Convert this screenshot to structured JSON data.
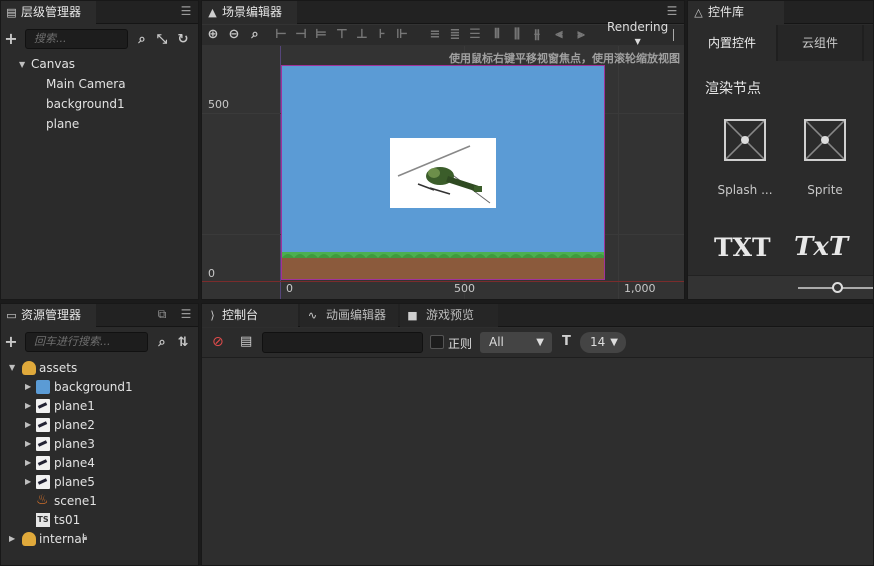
{
  "hierarchy": {
    "title": "层级管理器",
    "search_placeholder": "搜索...",
    "nodes": [
      {
        "label": "Canvas"
      },
      {
        "label": "Main Camera"
      },
      {
        "label": "background1"
      },
      {
        "label": "plane"
      }
    ]
  },
  "scene": {
    "title": "场景编辑器",
    "rendering_label": "Rendering",
    "hint": "使用鼠标右键平移视窗焦点，使用滚轮缩放视图",
    "ruler_left": [
      "500",
      "0"
    ],
    "ruler_bottom": [
      "0",
      "500",
      "1,000"
    ],
    "sky_color": "#5b9bd5",
    "ground_color": "#8b5a3c",
    "grass_color": "#4caf50"
  },
  "library": {
    "title": "控件库",
    "tabs": [
      "内置控件",
      "云组件"
    ],
    "section_title": "渲染节点",
    "items": [
      {
        "label": "Splash ..."
      },
      {
        "label": "Sprite"
      }
    ],
    "text_items": [
      "TXT",
      "TxT"
    ]
  },
  "assets": {
    "title": "资源管理器",
    "search_placeholder": "回车进行搜索...",
    "items": [
      {
        "label": "assets",
        "icon": "folder-icon"
      },
      {
        "label": "background1",
        "icon": "texture-icon"
      },
      {
        "label": "plane1",
        "icon": "plane-icon"
      },
      {
        "label": "plane2",
        "icon": "plane-icon"
      },
      {
        "label": "plane3",
        "icon": "plane-icon"
      },
      {
        "label": "plane4",
        "icon": "plane-icon"
      },
      {
        "label": "plane5",
        "icon": "plane-icon"
      },
      {
        "label": "scene1",
        "icon": "scene-icon"
      },
      {
        "label": "ts01",
        "icon": "ts-file-icon"
      },
      {
        "label": "internal",
        "icon": "folder-icon"
      }
    ]
  },
  "console": {
    "tabs": [
      "控制台",
      "动画编辑器",
      "游戏预览"
    ],
    "regex_label": "正则",
    "filter_value": "All",
    "font_size_value": "14"
  }
}
